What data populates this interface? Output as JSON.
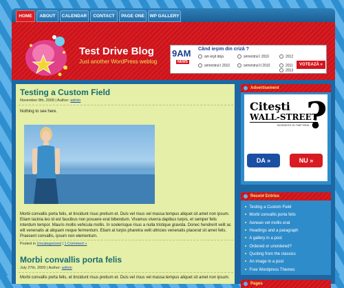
{
  "nav": {
    "items": [
      {
        "label": "HOME",
        "active": true
      },
      {
        "label": "ABOUT",
        "active": false
      },
      {
        "label": "CALENDAR",
        "active": false
      },
      {
        "label": "CONTACT",
        "active": false
      },
      {
        "label": "PAGE ONE",
        "active": false
      },
      {
        "label": "WP GALLERY",
        "active": false
      }
    ]
  },
  "header": {
    "title": "Test Drive Blog",
    "tagline": "Just another WordPress weblog"
  },
  "poll": {
    "brand": "9AM",
    "brand_sub": "NEWS",
    "question": "Când ieşim din criză ?",
    "options": [
      "am ieşit deja",
      "semestrul I 2010",
      "2012",
      "semestrul I 2010",
      "semestrul II 2010",
      "2011",
      "2013"
    ],
    "vote_label": "VOTEAZĂ »"
  },
  "posts": [
    {
      "title": "Testing a Custom Field",
      "date": "November 8th, 2009",
      "author_prefix": "| Author:",
      "author": "admin",
      "excerpt": "Nothing to see here.",
      "body": "Morbi convallis porta felis, et tincidunt risus pretium et. Duis vel risus vel massa tempus aliquet sit amet non ipsum. Etiam lacinia leo id est faucibus non posuere erat bibendum. Vivamus viverra dapibus turpis, et semper felis interdum tempor. Mauris mollis vehicula mollis. In scelerisque risus a nulla tristique gravida. Donec hendrerit velit ac elit venenatis at aliquam neque fermentum. Etiam at turpis pharetra velit ultricies venenatis placerat sit amet felis. Praesent convallis, ipsum non elementum.",
      "posted_in": "Posted in",
      "category": "Uncategorized",
      "comments": "1 Comment »"
    },
    {
      "title": "Morbi convallis porta felis",
      "date": "July 27th, 2009",
      "author_prefix": "| Author:",
      "author": "admin",
      "body": "Morbi convallis porta felis, et tincidunt risus pretium et. Duis vel risus vel massa tempus aliquet sit amet non ipsum."
    }
  ],
  "sidebar": {
    "ad_widget": {
      "title": "Advertisement",
      "ad_line1": "Citeşti",
      "ad_line2": "WALL-STREET",
      "ad_sub": "BUSINESS IN TIMP REAL",
      "ad_mark": "?",
      "yes_label": "DA »",
      "no_label": "NU »"
    },
    "recent": {
      "title": "Recent Entries",
      "items": [
        "Testing a Custom Field",
        "Morbi convallis porta felis",
        "Aenean vel mollis erat",
        "Headings and a paragraph",
        "A gallery in a post",
        "Ordered or unordered?",
        "Quoting from the classics",
        "An image in a post",
        "Free Wordpress Themes"
      ]
    },
    "pages": {
      "title": "Pages"
    }
  },
  "colors": {
    "accent_red": "#d81b22",
    "nav_blue": "#1a5f94",
    "title_teal": "#176c70",
    "content_bg": "#e5efa7"
  }
}
